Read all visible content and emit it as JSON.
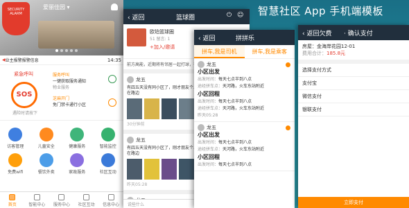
{
  "banner": {
    "title": "智慧社区 App 手机端模板"
  },
  "phone1": {
    "home_name": "爱丽佳园",
    "shield_text": "SECURITY ALARM",
    "alarm_text": "业主报警报警信息",
    "time": "14:35",
    "sos_title": "紧急呼叫",
    "sos_label": "SOS",
    "sos_sub": "遇险时请按下",
    "service1_title": "服务呼叫",
    "service1_desc": "一键获取服务通知",
    "service1_desc2": "物业服务",
    "service2_title": "芝麻开门",
    "service2_desc": "免门禁卡通行小区",
    "grid": [
      {
        "label": "访客管理",
        "color": "#3f7fe0",
        "icon": "visitor-icon"
      },
      {
        "label": "儿童安全",
        "color": "#ff8a1f",
        "icon": "child-icon"
      },
      {
        "label": "健康服务",
        "color": "#3fb57a",
        "icon": "health-icon"
      },
      {
        "label": "智能监控",
        "color": "#37b26f",
        "icon": "camera-icon"
      },
      {
        "label": "免费wifi",
        "color": "#ff9f0a",
        "icon": "wifi-icon"
      },
      {
        "label": "餐饮外卖",
        "color": "#4c9de8",
        "icon": "food-icon"
      },
      {
        "label": "家政服务",
        "color": "#8a6fe0",
        "icon": "cleaning-icon"
      },
      {
        "label": "社区互动",
        "color": "#3b7ad9",
        "icon": "community-icon"
      }
    ],
    "tabs": [
      {
        "label": "首页",
        "active": true
      },
      {
        "label": "智能中心",
        "active": false
      },
      {
        "label": "服务中心",
        "active": false
      },
      {
        "label": "社区互动",
        "active": false
      },
      {
        "label": "信息中心",
        "active": false
      }
    ]
  },
  "phone2": {
    "back": "返回",
    "title": "篮球圈",
    "product_title": "欧珀篮球圈",
    "product_stats": "51  留言: 1",
    "product_join": "+加入/邀请",
    "product_desc": "前方高能，近期将有邻居一起打球，有兴趣",
    "post1_user": "龙五",
    "post1_text": "有四五天没有同小区了，刚才朋友个人放在门口边的黄色芳香都在路边",
    "post1_meta": "30分钟前",
    "post2_user": "龙五",
    "post2_text": "有四五天没有同小区了，刚才朋友个人放在门口边的黄色芳香都在路边",
    "post2_meta": "昨天05:28",
    "post3_user": "龙五",
    "comment_placeholder": "说些什么"
  },
  "phone3": {
    "back": "返回",
    "title": "拼拼乐",
    "tab1": "拼车,我是司机",
    "tab2": "拼车,我是乘客",
    "cards": [
      {
        "user": "龙五",
        "heading": "小区出发",
        "time_label": "出发时间：",
        "time_value": "每天七点半到八点",
        "place_label": "途经拼车点：",
        "place_value": "天河路，火车东站附近",
        "heading2": "小区回程",
        "time2_value": "每天七点半到八点",
        "place2_value": "天河路，火车东站附近",
        "date": "昨天05:28"
      },
      {
        "user": "龙五",
        "heading": "小区出发",
        "time_label": "出发时间：",
        "time_value": "每天七点半到八点",
        "place_label": "途经拼车点：",
        "place_value": "天河路，火车东站附近",
        "heading2": "小区回程",
        "time2_value": "每天七点半到八点"
      }
    ]
  },
  "phone4": {
    "back": "返回欠费",
    "title": "确认支付",
    "room": "房屋：金海岸花园12-01",
    "amount_label": "费用合计：",
    "amount_value": "185.8元",
    "method_header": "选择支付方式",
    "methods": [
      "支付宝",
      "微信支付",
      "银联支付"
    ],
    "pay_button": "立即支付"
  }
}
